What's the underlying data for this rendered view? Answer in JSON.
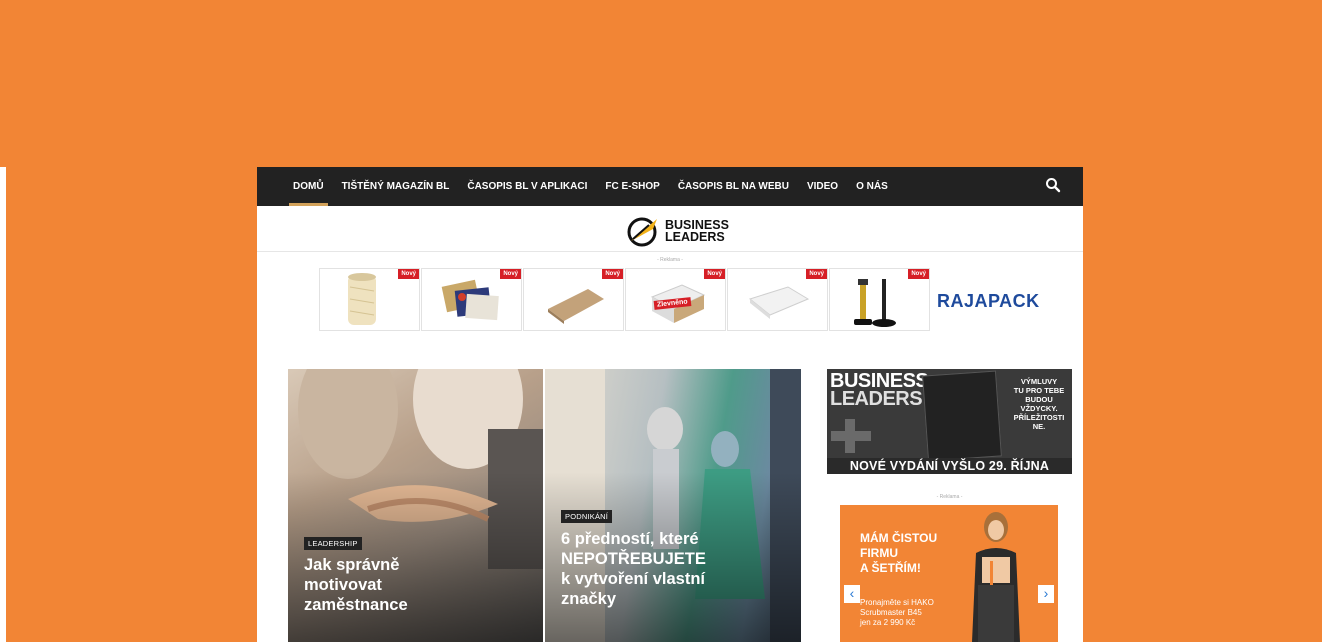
{
  "nav": {
    "items": [
      "DOMŮ",
      "TIŠTĚNÝ MAGAZÍN BL",
      "ČASOPIS BL V APLIKACI",
      "FC E-SHOP",
      "ČASOPIS BL NA WEBU",
      "VIDEO",
      "O NÁS"
    ],
    "active_index": 0
  },
  "logo": {
    "line1": "BUSINESS",
    "line2": "LEADERS"
  },
  "ad_label": "- Reklama -",
  "products": [
    {
      "badge": "Nový",
      "overlay": ""
    },
    {
      "badge": "Nový",
      "overlay": ""
    },
    {
      "badge": "Nový",
      "overlay": ""
    },
    {
      "badge": "Nový",
      "overlay": "Zlevněno"
    },
    {
      "badge": "Nový",
      "overlay": ""
    },
    {
      "badge": "Nový",
      "overlay": ""
    }
  ],
  "sponsor": "RAJAPACK",
  "hero": [
    {
      "category": "LEADERSHIP",
      "title_lines": [
        "Jak správně",
        "motivovat",
        "zaměstnance"
      ]
    },
    {
      "category": "PODNIKÁNÍ",
      "title_lines": [
        "6 předností, které",
        "NEPOTŘEBUJETE",
        "k vytvoření vlastní",
        "značky"
      ]
    }
  ],
  "sidebar": {
    "mag_title_1": "BUSINESS",
    "mag_title_2": "LEADERS",
    "side_text": [
      "VÝMLUVY",
      "TU PRO TEBE",
      "BUDOU",
      "VŽDYCKY.",
      "PŘÍLEŽITOSTI",
      "NE."
    ],
    "banner": "NOVÉ VYDÁNÍ VYŠLO 29. ŘÍJNA",
    "ad_label": "- Reklama -",
    "ad_head": [
      "MÁM ČISTOU",
      "FIRMU",
      "A ŠETŘÍM!"
    ],
    "ad_sub": [
      "Pronajměte si HAKO",
      "Scrubmaster B45",
      "jen za 2 990 Kč"
    ]
  },
  "colors": {
    "page_bg": "#f28535",
    "nav_bg": "#222222",
    "accent": "#d3a25a",
    "badge": "#d61f26",
    "raja": "#1e4a9c"
  }
}
